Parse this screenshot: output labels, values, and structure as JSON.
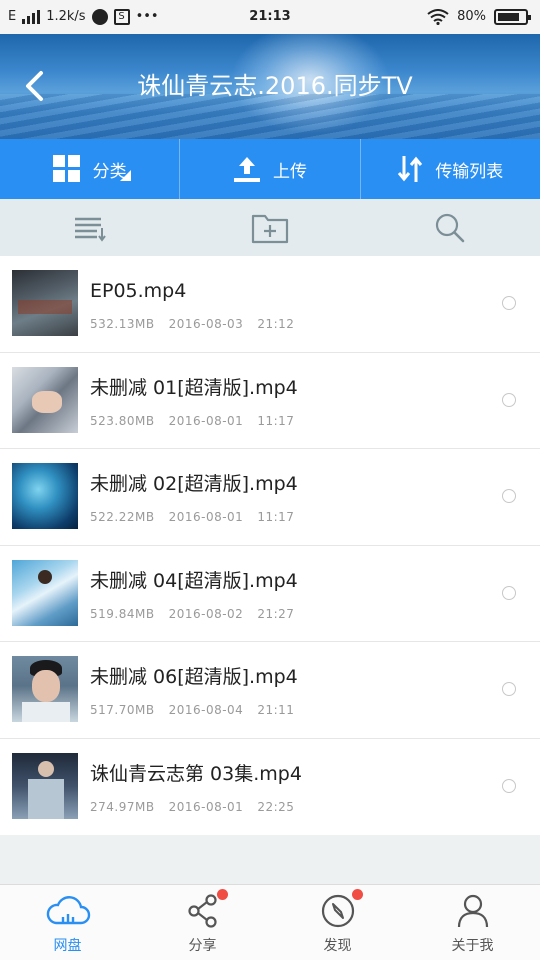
{
  "status_bar": {
    "network": "E",
    "speed": "1.2k/s",
    "more": "•••",
    "time": "21:13",
    "battery": "80",
    "battery_percent": 80
  },
  "header": {
    "title": "诛仙青云志.2016.同步TV"
  },
  "actions": [
    {
      "label": "分类",
      "icon": "grid-icon"
    },
    {
      "label": "上传",
      "icon": "upload-icon"
    },
    {
      "label": "传输列表",
      "icon": "transfer-icon"
    }
  ],
  "tools": [
    {
      "icon": "sort-list-icon"
    },
    {
      "icon": "new-folder-icon"
    },
    {
      "icon": "search-icon"
    }
  ],
  "files": [
    {
      "name": "EP05.mp4",
      "size": "532.13MB",
      "date": "2016-08-03",
      "time": "21:12"
    },
    {
      "name": "未删减 01[超清版].mp4",
      "size": "523.80MB",
      "date": "2016-08-01",
      "time": "11:17"
    },
    {
      "name": "未删减 02[超清版].mp4",
      "size": "522.22MB",
      "date": "2016-08-01",
      "time": "11:17"
    },
    {
      "name": "未删减 04[超清版].mp4",
      "size": "519.84MB",
      "date": "2016-08-02",
      "time": "21:27"
    },
    {
      "name": "未删减 06[超清版].mp4",
      "size": "517.70MB",
      "date": "2016-08-04",
      "time": "21:11"
    },
    {
      "name": "诛仙青云志第 03集.mp4",
      "size": "274.97MB",
      "date": "2016-08-01",
      "time": "22:25"
    }
  ],
  "nav": [
    {
      "label": "网盘",
      "icon": "cloud-icon",
      "active": true
    },
    {
      "label": "分享",
      "icon": "share-icon",
      "badge": true
    },
    {
      "label": "发现",
      "icon": "compass-icon",
      "badge": true
    },
    {
      "label": "关于我",
      "icon": "person-icon"
    }
  ],
  "colors": {
    "accent": "#2a8ff2",
    "badge": "#f04d45"
  }
}
